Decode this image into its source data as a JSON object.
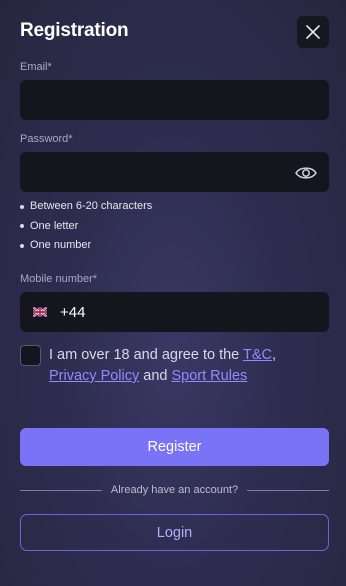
{
  "modal": {
    "title": "Registration",
    "close_icon": "close-icon"
  },
  "email": {
    "label": "Email*",
    "value": ""
  },
  "password": {
    "label": "Password*",
    "value": "",
    "toggle_icon": "eye-icon",
    "rules": [
      "Between 6-20 characters",
      "One letter",
      "One number"
    ]
  },
  "mobile": {
    "label": "Mobile number*",
    "flag_icon": "uk-flag-icon",
    "dial_code": "+44"
  },
  "agreement": {
    "checked": false,
    "text_before": "I am over 18 and agree to the ",
    "tc_link": "T&C",
    "comma": ",",
    "privacy_link": "Privacy Policy",
    "and_text": " and ",
    "sport_rules_link": "Sport Rules"
  },
  "actions": {
    "register_label": "Register",
    "divider_text": "Already have an account?",
    "login_label": "Login"
  },
  "colors": {
    "accent": "#7a72f7",
    "link": "#8e8cff",
    "input_bg": "#15151d"
  }
}
